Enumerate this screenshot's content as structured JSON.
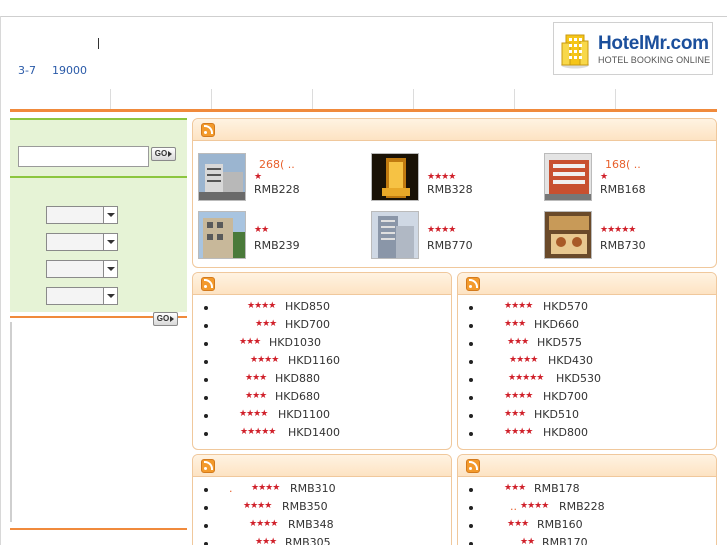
{
  "header": {
    "date_range": "3-7",
    "count": "19000"
  },
  "logo": {
    "brand_main": "HotelMr",
    "brand_suffix": ".com",
    "tagline": "HOTEL BOOKING ONLINE"
  },
  "search": {
    "go_label": "GO",
    "input_value": ""
  },
  "colors": {
    "accent": "#f08a3c",
    "sidebar_bg": "#e6f3d6",
    "sidebar_border": "#8cc63f",
    "star": "#d0202a",
    "link": "#2a5aa8"
  },
  "featured": {
    "hotels": [
      {
        "name": "268( ..",
        "stars": "★",
        "price": "RMB228"
      },
      {
        "name": "",
        "stars": "★★★★",
        "price": "RMB328"
      },
      {
        "name": "168( ..",
        "stars": "★",
        "price": "RMB168"
      },
      {
        "name": "",
        "stars": "★★",
        "price": "RMB239"
      },
      {
        "name": "",
        "stars": "★★★★",
        "price": "RMB770"
      },
      {
        "name": "",
        "stars": "★★★★★",
        "price": "RMB730"
      }
    ]
  },
  "list_left_top": [
    {
      "stars": "★★★★",
      "price": "HKD850"
    },
    {
      "stars": "★★★",
      "price": "HKD700"
    },
    {
      "stars": "★★★",
      "price": "HKD1030"
    },
    {
      "stars": "★★★★",
      "price": "HKD1160"
    },
    {
      "stars": "★★★",
      "price": "HKD880"
    },
    {
      "stars": "★★★",
      "price": "HKD680"
    },
    {
      "stars": "★★★★",
      "price": "HKD1100"
    },
    {
      "stars": "★★★★★",
      "price": "HKD1400"
    }
  ],
  "list_right_top": [
    {
      "stars": "★★★★",
      "price": "HKD570"
    },
    {
      "stars": "★★★",
      "price": "HKD660"
    },
    {
      "stars": "★★★",
      "price": "HKD575"
    },
    {
      "stars": "★★★★",
      "price": "HKD430"
    },
    {
      "stars": "★★★★★",
      "price": "HKD530"
    },
    {
      "stars": "★★★★",
      "price": "HKD700"
    },
    {
      "stars": "★★★",
      "price": "HKD510"
    },
    {
      "stars": "★★★★",
      "price": "HKD800"
    }
  ],
  "list_left_bottom": [
    {
      "pre": ".",
      "stars": "★★★★",
      "price": "RMB310"
    },
    {
      "pre": "",
      "stars": "★★★★",
      "price": "RMB350"
    },
    {
      "pre": "",
      "stars": "★★★★",
      "price": "RMB348"
    },
    {
      "pre": "",
      "stars": "★★★",
      "price": "RMB305"
    }
  ],
  "list_right_bottom": [
    {
      "pre": "",
      "stars": "★★★",
      "price": "RMB178"
    },
    {
      "pre": "..",
      "stars": "★★★★",
      "price": "RMB228"
    },
    {
      "pre": "",
      "stars": "★★★",
      "price": "RMB160"
    },
    {
      "pre": "",
      "stars": "★★",
      "price": "RMB170"
    }
  ]
}
